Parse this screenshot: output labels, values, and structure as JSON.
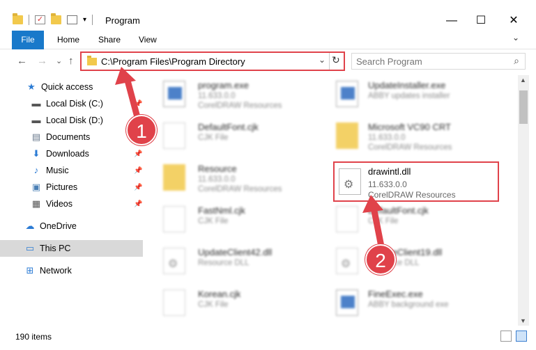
{
  "window": {
    "title": "Program",
    "minimize": "—",
    "maximize": "☐",
    "close": "✕"
  },
  "ribbon": {
    "tabs": [
      "File",
      "Home",
      "Share",
      "View"
    ],
    "expand": "⌄"
  },
  "nav": {
    "back": "←",
    "forward": "→",
    "recent": "⌄",
    "up": "↑",
    "address": "C:\\Program Files\\Program Directory",
    "search_placeholder": "Search Program"
  },
  "sidebar": {
    "items": [
      {
        "label": "Quick access",
        "icon": "star-icon",
        "glyph": "★",
        "color": "#2b7bd4"
      },
      {
        "label": "Local Disk (C:)",
        "icon": "drive-icon",
        "glyph": "▬",
        "color": "#555555"
      },
      {
        "label": "Local Disk (D:)",
        "icon": "drive-icon",
        "glyph": "▬",
        "color": "#555555"
      },
      {
        "label": "Documents",
        "icon": "documents-icon",
        "glyph": "▤",
        "color": "#6a7a8c"
      },
      {
        "label": "Downloads",
        "icon": "download-icon",
        "glyph": "⬇",
        "color": "#2b7bd4"
      },
      {
        "label": "Music",
        "icon": "music-icon",
        "glyph": "♪",
        "color": "#2b7bd4"
      },
      {
        "label": "Pictures",
        "icon": "pictures-icon",
        "glyph": "▣",
        "color": "#4a7fb5"
      },
      {
        "label": "Videos",
        "icon": "videos-icon",
        "glyph": "▦",
        "color": "#555555"
      },
      {
        "label": "OneDrive",
        "icon": "cloud-icon",
        "glyph": "☁",
        "color": "#2b7bd4"
      },
      {
        "label": "This PC",
        "icon": "computer-icon",
        "glyph": "▭",
        "color": "#2b7bd4"
      },
      {
        "label": "Network",
        "icon": "network-icon",
        "glyph": "⊞",
        "color": "#2b7bd4"
      }
    ],
    "pin": "📌"
  },
  "files": [
    {
      "name": "program.exe",
      "line1": "11.633.0.0",
      "line2": "CorelDRAW Resources",
      "icon": "exe"
    },
    {
      "name": "UpdateInstaller.exe",
      "line1": "ABBY updates installer",
      "line2": "",
      "icon": "exe"
    },
    {
      "name": "DefaultFont.cjk",
      "line1": "CJK File",
      "line2": "",
      "icon": "doc"
    },
    {
      "name": "Microsoft VC90 CRT",
      "line1": "11.633.0.0",
      "line2": "CorelDRAW Resources",
      "icon": "folder"
    },
    {
      "name": "Resource",
      "line1": "11.633.0.0",
      "line2": "CorelDRAW Resources",
      "icon": "folder"
    },
    {
      "name": "FastNml.cjk",
      "line1": "CJK File",
      "line2": "",
      "icon": "doc"
    },
    {
      "name": "DefaultFont.cjk",
      "line1": "CJK File",
      "line2": "",
      "icon": "doc"
    },
    {
      "name": "UpdateClient42.dll",
      "line1": "Resource DLL",
      "line2": "",
      "icon": "dll"
    },
    {
      "name": "UpdateClient19.dll",
      "line1": "Resource DLL",
      "line2": "",
      "icon": "dll"
    },
    {
      "name": "Korean.cjk",
      "line1": "CJK File",
      "line2": "",
      "icon": "doc"
    },
    {
      "name": "FineExec.exe",
      "line1": "ABBY background exe",
      "line2": "",
      "icon": "exe"
    }
  ],
  "highlighted_file": {
    "name": "drawintl.dll",
    "line1": "11.633.0.0",
    "line2": "CorelDRAW Resources"
  },
  "annotations": {
    "step1": "1",
    "step2": "2",
    "accent": "#e0424a"
  },
  "status": {
    "count": "190 items"
  }
}
